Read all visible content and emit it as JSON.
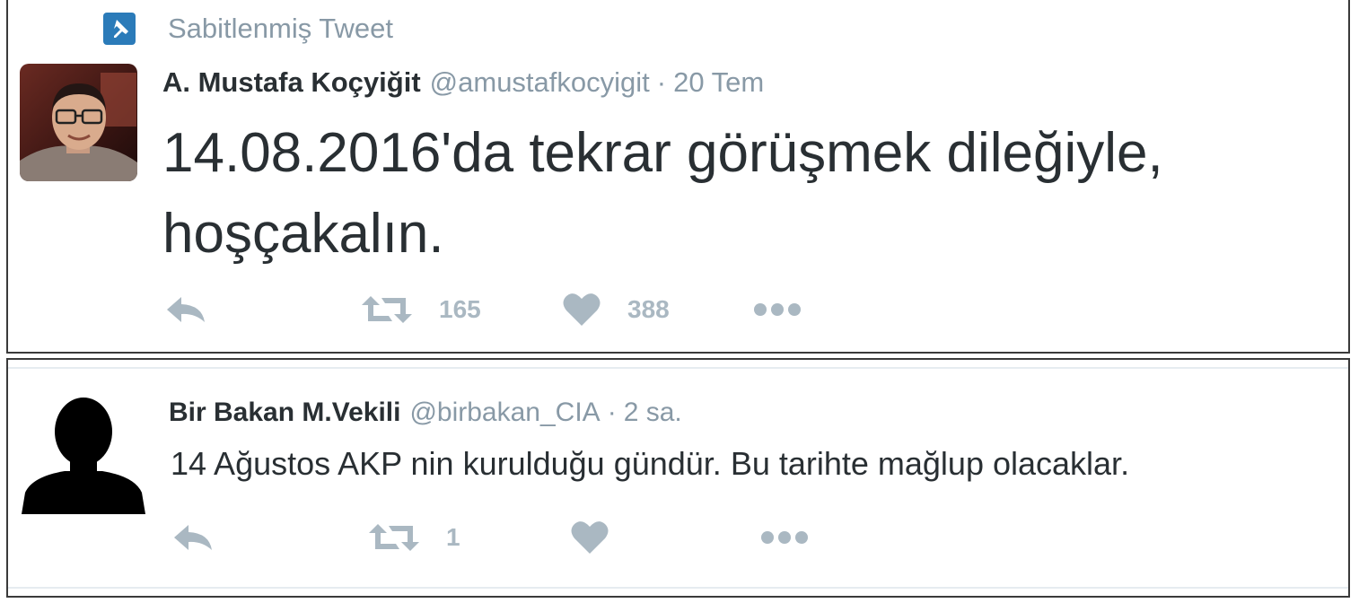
{
  "pinned": {
    "label": "Sabitlenmiş Tweet",
    "icon": "pin-icon"
  },
  "tweets": [
    {
      "fullname": "A. Mustafa Koçyiğit",
      "handle": "@amustafkocyigit",
      "separator": "·",
      "time": "20 Tem",
      "text": "14.08.2016'da tekrar görüşmek dileğiyle, hoşçakalın.",
      "retweets": "165",
      "likes": "388",
      "avatar": "profile-photo"
    },
    {
      "fullname": "Bir Bakan M.Vekili",
      "handle": "@birbakan_CIA",
      "separator": "·",
      "time": "2 sa.",
      "text": "14 Ağustos AKP nin kurulduğu gündür. Bu tarihte mağlup olacaklar.",
      "retweets": "1",
      "likes": "",
      "avatar": "default-silhouette"
    }
  ],
  "colors": {
    "text": "#292f33",
    "muted": "#8899a6",
    "action": "#aab8c2",
    "pin_badge": "#2b7bb9",
    "card_border": "#3a3a3a"
  }
}
